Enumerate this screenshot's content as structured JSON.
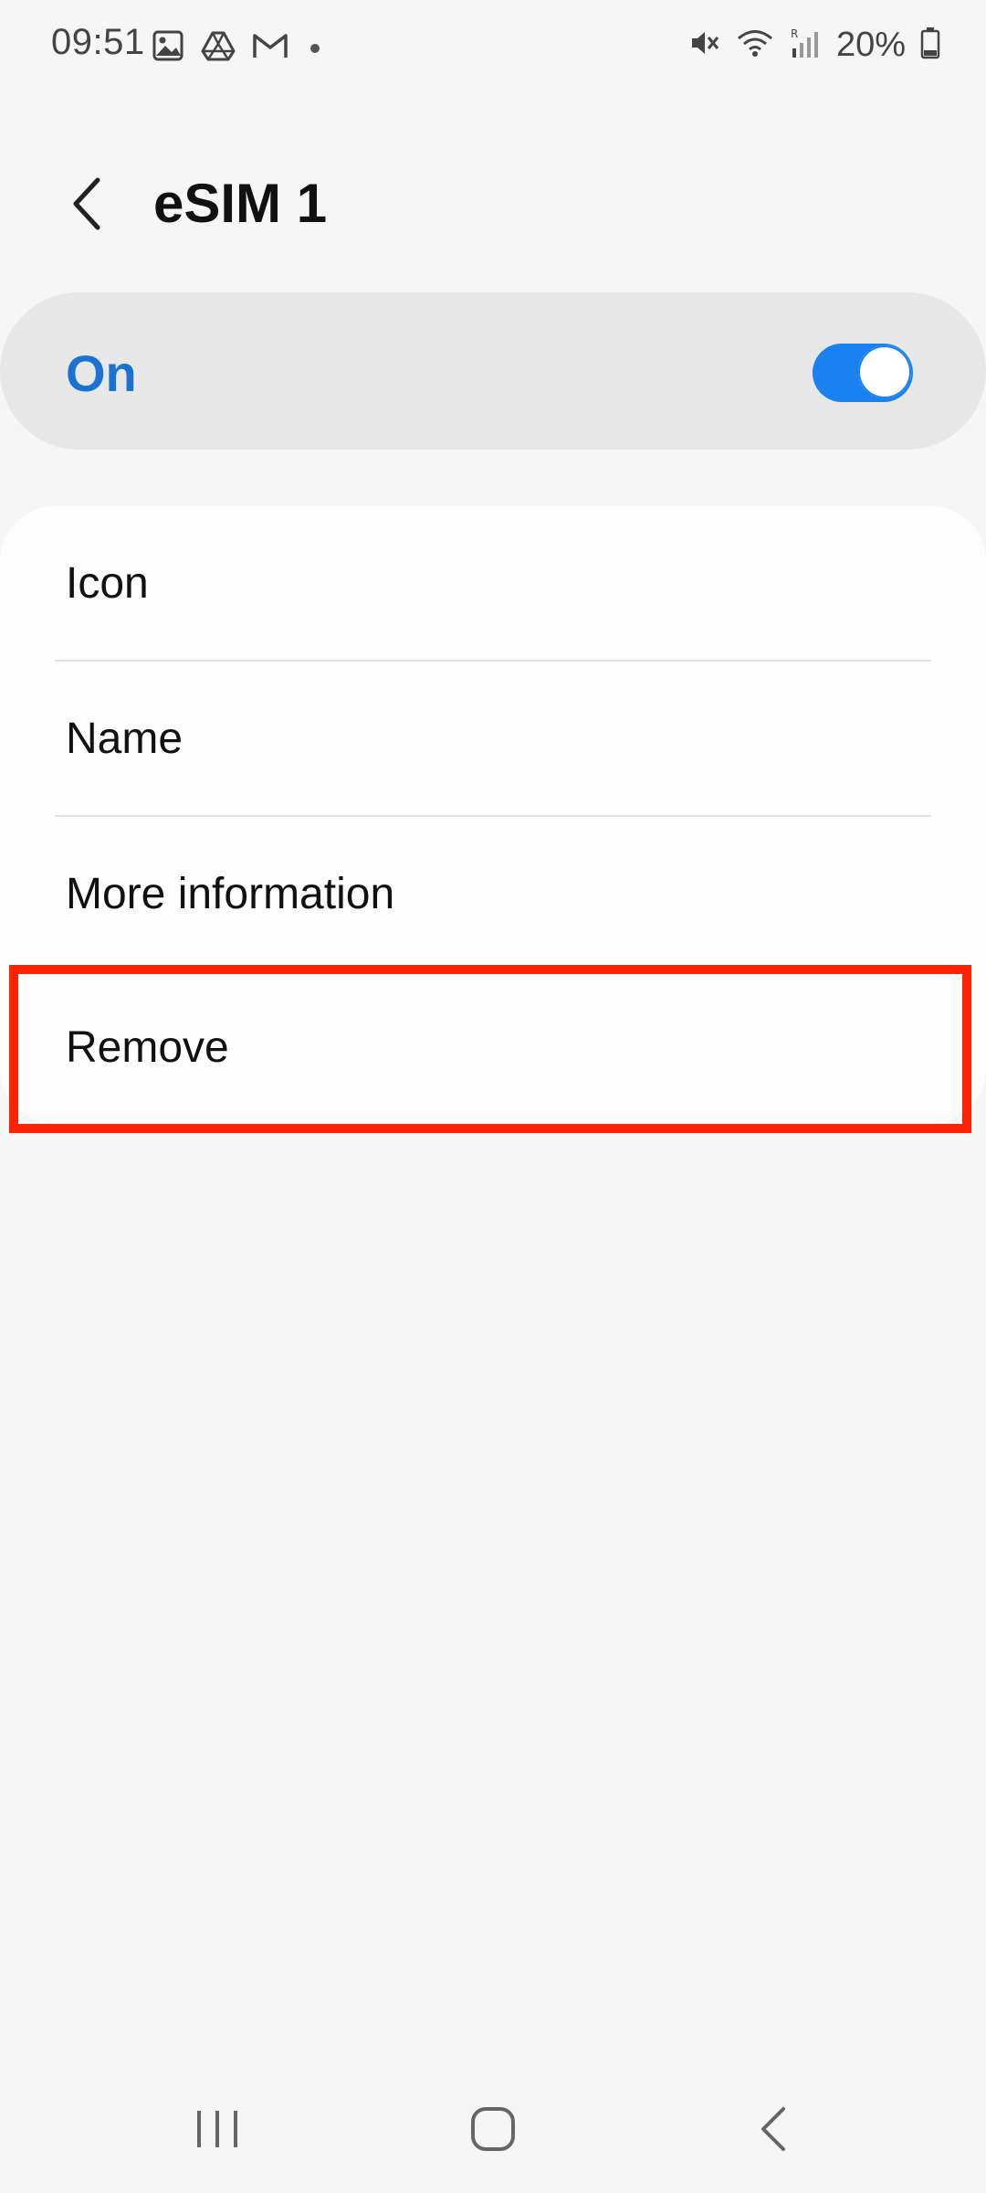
{
  "status_bar": {
    "time": "09:51",
    "battery": "20%",
    "icons_left": [
      "gallery-icon",
      "drive-icon",
      "gmail-icon",
      "notification-dot"
    ],
    "icons_right": [
      "mute-icon",
      "wifi-icon",
      "signal-roaming-icon",
      "battery-icon"
    ]
  },
  "header": {
    "back_icon": "back-arrow-icon",
    "title": "eSIM 1"
  },
  "toggle": {
    "label": "On",
    "state": true,
    "accent_color": "#1a82f0"
  },
  "list": {
    "items": [
      {
        "label": "Icon"
      },
      {
        "label": "Name"
      },
      {
        "label": "More information"
      },
      {
        "label": "Remove"
      }
    ]
  },
  "highlight": {
    "target": "Remove",
    "color": "#ff2200"
  },
  "nav_bar": {
    "icons": [
      "recents-icon",
      "home-icon",
      "back-icon"
    ]
  }
}
